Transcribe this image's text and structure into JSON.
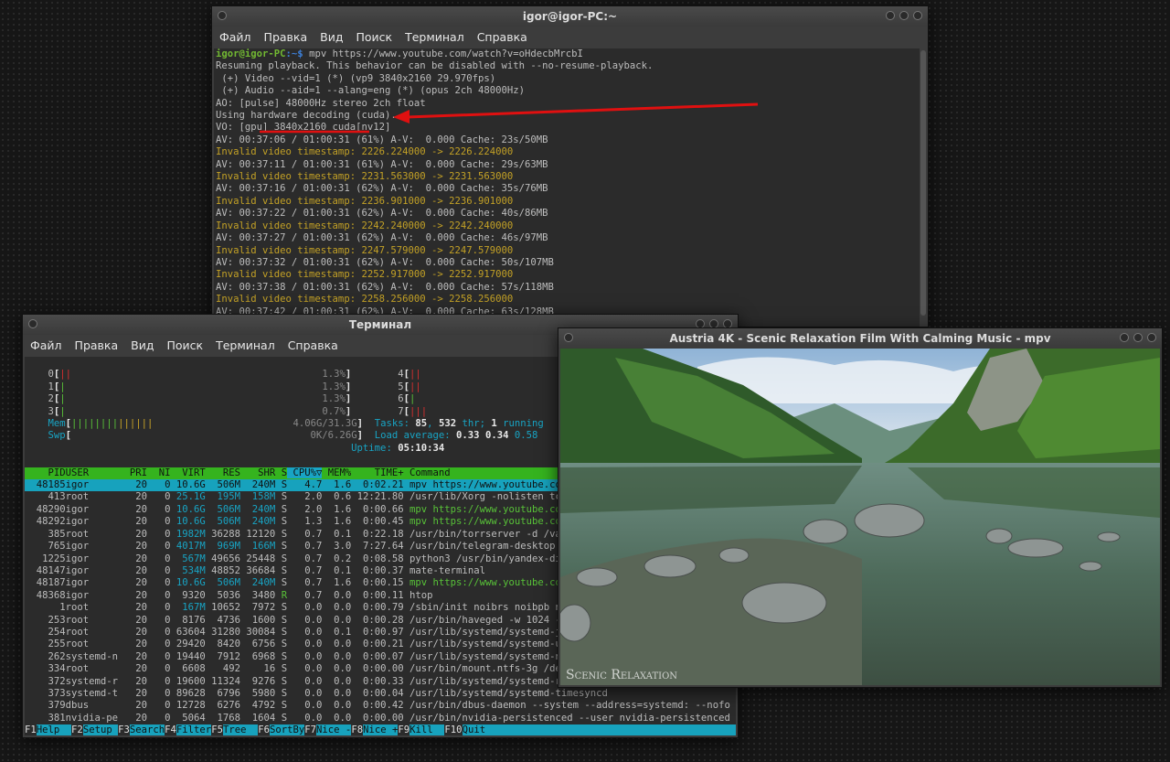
{
  "top_window": {
    "title": "igor@igor-PC:~",
    "menu": [
      "Файл",
      "Правка",
      "Вид",
      "Поиск",
      "Терминал",
      "Справка"
    ],
    "prompt_user": "igor@igor-PC",
    "prompt_path": ":~$",
    "command": " mpv https://www.youtube.com/watch?v=oHdecbMrcbI",
    "lines": [
      {
        "t": "Resuming playback. This behavior can be disabled with --no-resume-playback.",
        "c": ""
      },
      {
        "t": " (+) Video --vid=1 (*) (vp9 3840x2160 29.970fps)",
        "c": ""
      },
      {
        "t": " (+) Audio --aid=1 --alang=eng (*) (opus 2ch 48000Hz)",
        "c": ""
      },
      {
        "t": "AO: [pulse] 48000Hz stereo 2ch float",
        "c": ""
      },
      {
        "t": "Using hardware decoding (cuda).",
        "c": ""
      },
      {
        "t": "VO: [gpu] 3840x2160 cuda[nv12]",
        "c": ""
      },
      {
        "t": "AV: 00:37:06 / 01:00:31 (61%) A-V:  0.000 Cache: 23s/50MB",
        "c": ""
      },
      {
        "t": "Invalid video timestamp: 2226.224000 -> 2226.224000",
        "c": "ly"
      },
      {
        "t": "AV: 00:37:11 / 01:00:31 (61%) A-V:  0.000 Cache: 29s/63MB",
        "c": ""
      },
      {
        "t": "Invalid video timestamp: 2231.563000 -> 2231.563000",
        "c": "ly"
      },
      {
        "t": "AV: 00:37:16 / 01:00:31 (62%) A-V:  0.000 Cache: 35s/76MB",
        "c": ""
      },
      {
        "t": "Invalid video timestamp: 2236.901000 -> 2236.901000",
        "c": "ly"
      },
      {
        "t": "AV: 00:37:22 / 01:00:31 (62%) A-V:  0.000 Cache: 40s/86MB",
        "c": ""
      },
      {
        "t": "Invalid video timestamp: 2242.240000 -> 2242.240000",
        "c": "ly"
      },
      {
        "t": "AV: 00:37:27 / 01:00:31 (62%) A-V:  0.000 Cache: 46s/97MB",
        "c": ""
      },
      {
        "t": "Invalid video timestamp: 2247.579000 -> 2247.579000",
        "c": "ly"
      },
      {
        "t": "AV: 00:37:32 / 01:00:31 (62%) A-V:  0.000 Cache: 50s/107MB",
        "c": ""
      },
      {
        "t": "Invalid video timestamp: 2252.917000 -> 2252.917000",
        "c": "ly"
      },
      {
        "t": "AV: 00:37:38 / 01:00:31 (62%) A-V:  0.000 Cache: 57s/118MB",
        "c": ""
      },
      {
        "t": "Invalid video timestamp: 2258.256000 -> 2258.256000",
        "c": "ly"
      },
      {
        "t": "AV: 00:37:42 / 01:00:31 (62%) A-V:  0.000 Cache: 63s/128MB",
        "c": ""
      }
    ]
  },
  "htop_window": {
    "title": "Терминал",
    "menu": [
      "Файл",
      "Правка",
      "Вид",
      "Поиск",
      "Терминал",
      "Справка"
    ],
    "cpus_left": [
      {
        "id": "0",
        "bar": "||",
        "pct": "1.3%"
      },
      {
        "id": "1",
        "bar": "|",
        "pct": "1.3%"
      },
      {
        "id": "2",
        "bar": "|",
        "pct": "1.3%"
      },
      {
        "id": "3",
        "bar": "|",
        "pct": "0.7%"
      }
    ],
    "cpus_right": [
      {
        "id": "4",
        "bar": "||"
      },
      {
        "id": "5",
        "bar": "||"
      },
      {
        "id": "6",
        "bar": "|"
      },
      {
        "id": "7",
        "bar": "|||"
      }
    ],
    "mem_label": "Mem",
    "mem_bar_green": "||||||||",
    "mem_bar_yellow": "||||||",
    "mem_value": "4.06G/31.3G",
    "swp_label": "Swp",
    "swp_value": "0K/6.26G",
    "tasks_label": "Tasks: ",
    "tasks_count": "85",
    "thr_count": "532",
    "thr_label": " thr; ",
    "running_count": "1",
    "running_label": " running",
    "load_label": "Load average: ",
    "load1": "0.33",
    "load5": "0.34",
    "load15": "0.58",
    "uptime_label": "Uptime: ",
    "uptime": "05:10:34",
    "header": [
      "PID",
      "USER",
      "PRI",
      "NI",
      "VIRT",
      "RES",
      "SHR",
      "S",
      "CPU%▽",
      "MEM%",
      "TIME+",
      "Command"
    ],
    "rows": [
      [
        "48185",
        "igor",
        "20",
        "0",
        "10.6G",
        "506M",
        "240M",
        "S",
        "4.7",
        "1.6",
        "0:02.21",
        "mpv https://www.youtube.co"
      ],
      [
        "413",
        "root",
        "20",
        "0",
        "25.1G",
        "195M",
        "158M",
        "S",
        "2.0",
        "0.6",
        "12:21.80",
        "/usr/lib/Xorg -nolisten tc"
      ],
      [
        "48290",
        "igor",
        "20",
        "0",
        "10.6G",
        "506M",
        "240M",
        "S",
        "2.0",
        "1.6",
        "0:00.66",
        "mpv https://www.youtube.co"
      ],
      [
        "48292",
        "igor",
        "20",
        "0",
        "10.6G",
        "506M",
        "240M",
        "S",
        "1.3",
        "1.6",
        "0:00.45",
        "mpv https://www.youtube.co"
      ],
      [
        "385",
        "root",
        "20",
        "0",
        "1982M",
        "36288",
        "12120",
        "S",
        "0.7",
        "0.1",
        "0:22.18",
        "/usr/bin/torrserver -d /va"
      ],
      [
        "765",
        "igor",
        "20",
        "0",
        "4017M",
        "969M",
        "166M",
        "S",
        "0.7",
        "3.0",
        "7:27.64",
        "/usr/bin/telegram-desktop"
      ],
      [
        "1225",
        "igor",
        "20",
        "0",
        "567M",
        "49656",
        "25448",
        "S",
        "0.7",
        "0.2",
        "0:08.58",
        "python3 /usr/bin/yandex-di"
      ],
      [
        "48147",
        "igor",
        "20",
        "0",
        "534M",
        "48852",
        "36684",
        "S",
        "0.7",
        "0.1",
        "0:00.37",
        "mate-terminal"
      ],
      [
        "48187",
        "igor",
        "20",
        "0",
        "10.6G",
        "506M",
        "240M",
        "S",
        "0.7",
        "1.6",
        "0:00.15",
        "mpv https://www.youtube.co"
      ],
      [
        "48368",
        "igor",
        "20",
        "0",
        "9320",
        "5036",
        "3480",
        "R",
        "0.7",
        "0.0",
        "0:00.11",
        "htop"
      ],
      [
        "1",
        "root",
        "20",
        "0",
        "167M",
        "10652",
        "7972",
        "S",
        "0.0",
        "0.0",
        "0:00.79",
        "/sbin/init noibrs noibpb n"
      ],
      [
        "253",
        "root",
        "20",
        "0",
        "8176",
        "4736",
        "1600",
        "S",
        "0.0",
        "0.0",
        "0:00.28",
        "/usr/bin/haveged -w 1024 -"
      ],
      [
        "254",
        "root",
        "20",
        "0",
        "63604",
        "31280",
        "30084",
        "S",
        "0.0",
        "0.1",
        "0:00.97",
        "/usr/lib/systemd/systemd-j"
      ],
      [
        "255",
        "root",
        "20",
        "0",
        "29420",
        "8420",
        "6756",
        "S",
        "0.0",
        "0.0",
        "0:00.21",
        "/usr/lib/systemd/systemd-u"
      ],
      [
        "262",
        "systemd-n",
        "20",
        "0",
        "19440",
        "7912",
        "6968",
        "S",
        "0.0",
        "0.0",
        "0:00.07",
        "/usr/lib/systemd/systemd-n"
      ],
      [
        "334",
        "root",
        "20",
        "0",
        "6608",
        "492",
        "16",
        "S",
        "0.0",
        "0.0",
        "0:00.00",
        "/usr/bin/mount.ntfs-3g /de"
      ],
      [
        "372",
        "systemd-r",
        "20",
        "0",
        "19600",
        "11324",
        "9276",
        "S",
        "0.0",
        "0.0",
        "0:00.33",
        "/usr/lib/systemd/systemd-r"
      ],
      [
        "373",
        "systemd-t",
        "20",
        "0",
        "89628",
        "6796",
        "5980",
        "S",
        "0.0",
        "0.0",
        "0:00.04",
        "/usr/lib/systemd/systemd-timesyncd"
      ],
      [
        "379",
        "dbus",
        "20",
        "0",
        "12728",
        "6276",
        "4792",
        "S",
        "0.0",
        "0.0",
        "0:00.42",
        "/usr/bin/dbus-daemon --system --address=systemd: --nofo"
      ],
      [
        "381",
        "nvidia-pe",
        "20",
        "0",
        "5064",
        "1768",
        "1604",
        "S",
        "0.0",
        "0.0",
        "0:00.00",
        "/usr/bin/nvidia-persistenced --user nvidia-persistenced"
      ]
    ],
    "fkeys": [
      {
        "k": "F1",
        "v": "Help  "
      },
      {
        "k": "F2",
        "v": "Setup "
      },
      {
        "k": "F3",
        "v": "Search"
      },
      {
        "k": "F4",
        "v": "Filter"
      },
      {
        "k": "F5",
        "v": "Tree  "
      },
      {
        "k": "F6",
        "v": "SortBy"
      },
      {
        "k": "F7",
        "v": "Nice -"
      },
      {
        "k": "F8",
        "v": "Nice +"
      },
      {
        "k": "F9",
        "v": "Kill  "
      },
      {
        "k": "F10",
        "v": "Quit"
      }
    ]
  },
  "mpv_window": {
    "title": "Austria 4K - Scenic Relaxation Film With Calming Music - mpv",
    "watermark": "Scenic Relaxation"
  },
  "colors": {
    "accent_cyan": "#17a2bd",
    "header_green": "#35b31e",
    "annotation_red": "#e01010"
  }
}
